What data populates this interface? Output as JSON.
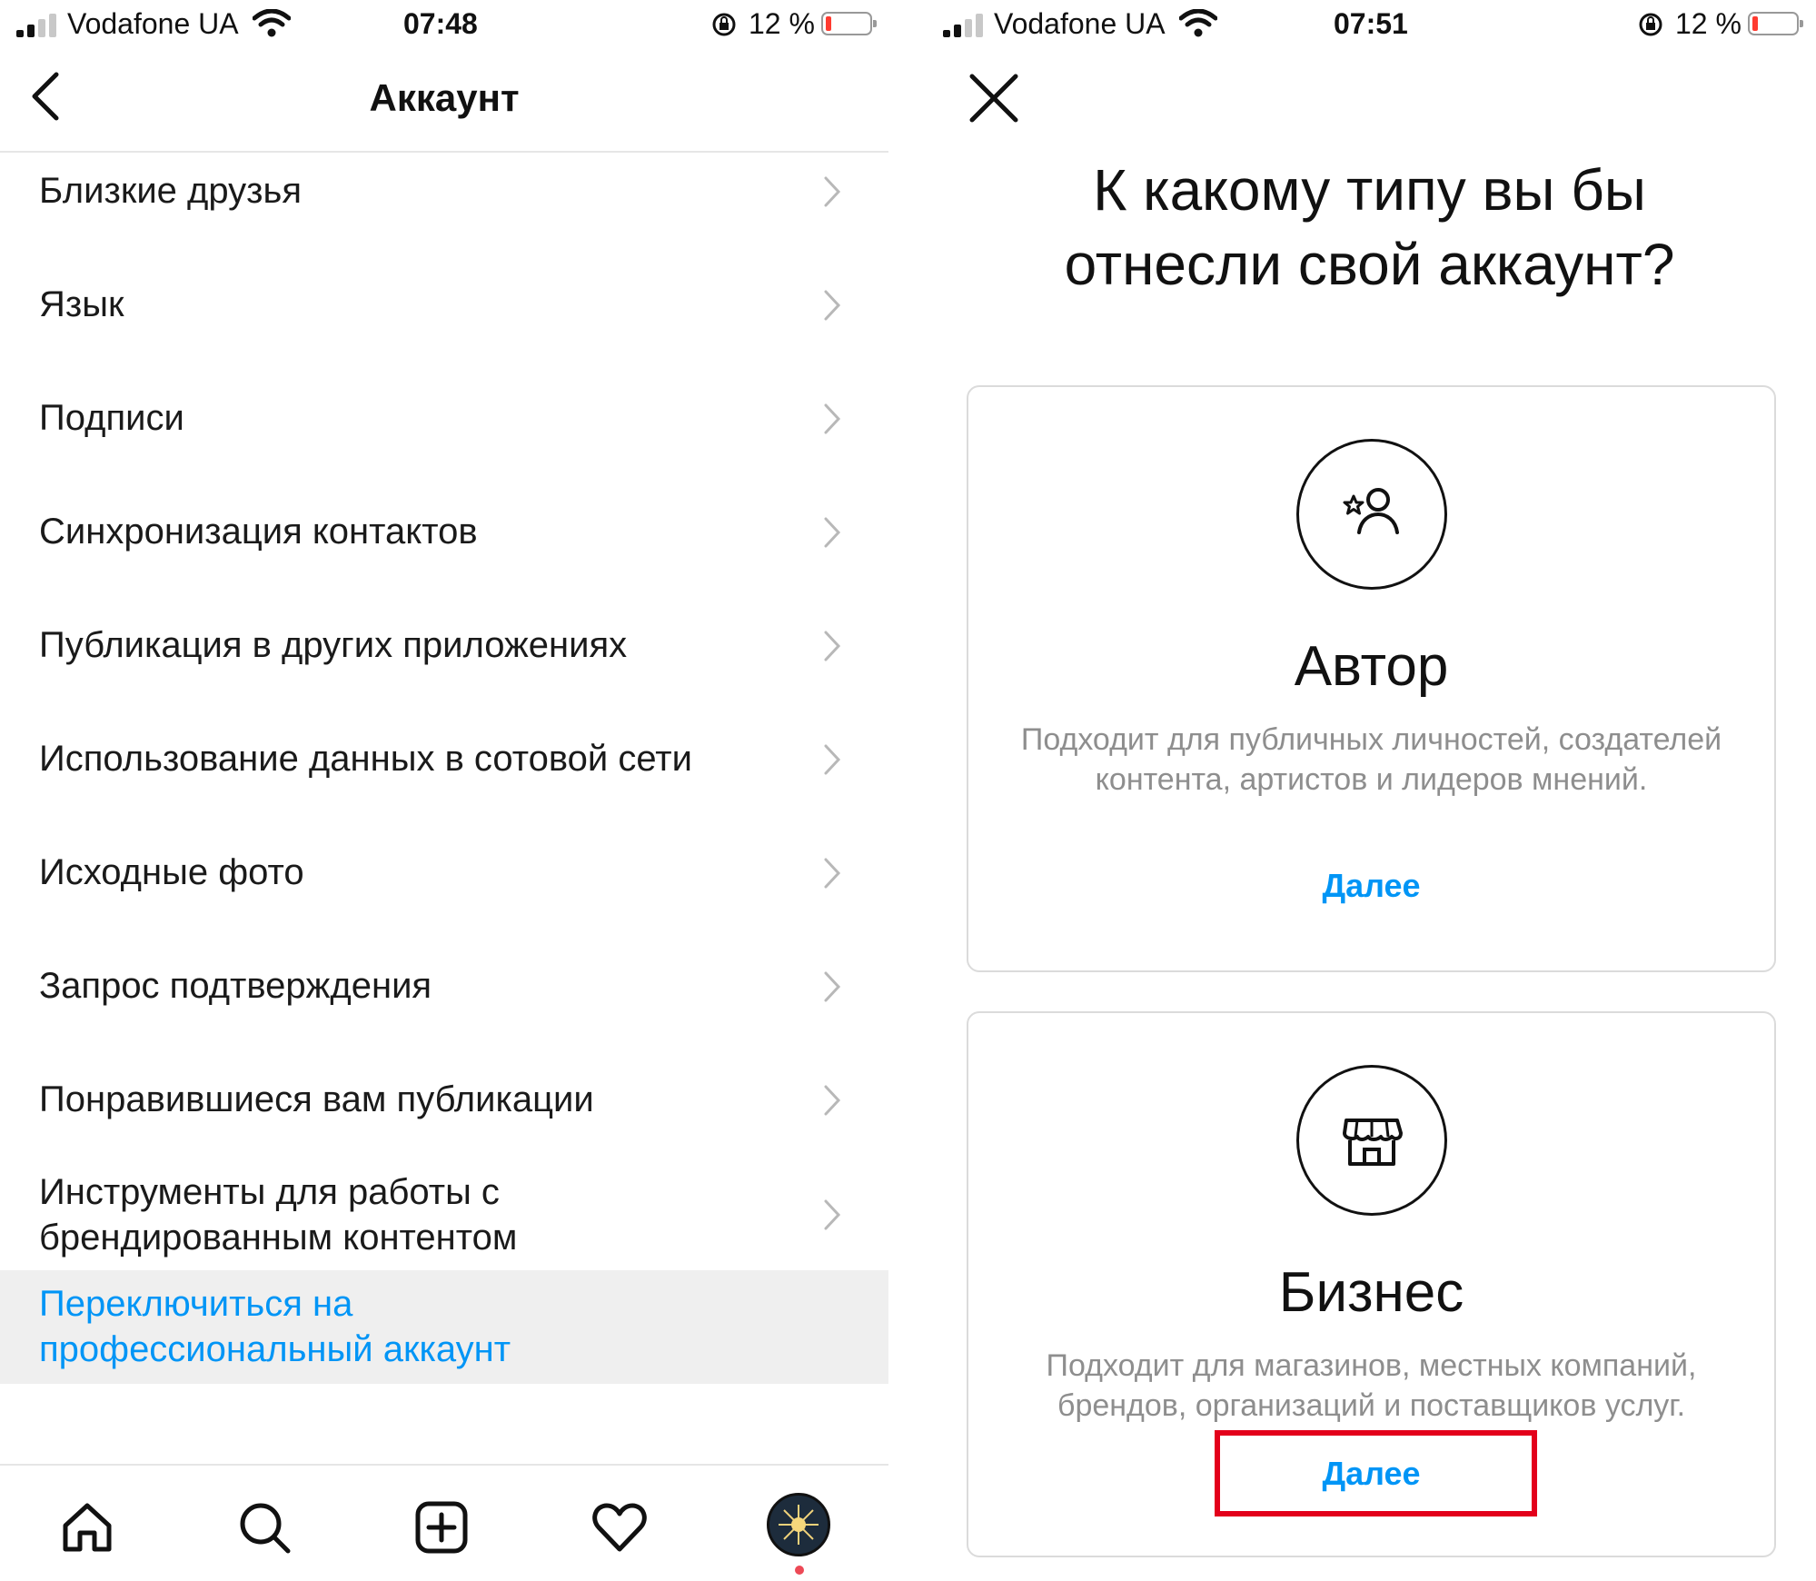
{
  "left_screen": {
    "status_bar": {
      "carrier": "Vodafone UA",
      "time": "07:48",
      "battery": "12 %"
    },
    "header": {
      "title": "Аккаунт"
    },
    "menu_items": [
      {
        "label": "Близкие друзья"
      },
      {
        "label": "Язык"
      },
      {
        "label": "Подписи"
      },
      {
        "label": "Синхронизация контактов"
      },
      {
        "label": "Публикация в других приложениях"
      },
      {
        "label": "Использование данных в сотовой сети"
      },
      {
        "label": "Исходные фото"
      },
      {
        "label": "Запрос подтверждения"
      },
      {
        "label": "Понравившиеся вам публикации"
      },
      {
        "label": "Инструменты для работы с брендированным контентом"
      }
    ],
    "switch_link": {
      "label": "Переключиться на профессиональный аккаунт"
    },
    "tab_bar": {
      "tabs": [
        "home-icon",
        "search-icon",
        "new-post-icon",
        "activity-heart-icon",
        "profile-avatar"
      ]
    }
  },
  "right_screen": {
    "status_bar": {
      "carrier": "Vodafone UA",
      "time": "07:51",
      "battery": "12 %"
    },
    "question": "К какому типу вы бы отнесли свой аккаунт?",
    "cards": [
      {
        "icon": "creator-icon",
        "title": "Автор",
        "description": "Подходит для публичных личностей, создателей контента, артистов и лидеров мнений.",
        "next_label": "Далее"
      },
      {
        "icon": "shop-icon",
        "title": "Бизнес",
        "description": "Подходит для магазинов, местных компаний, брендов, организаций и поставщиков услуг.",
        "next_label": "Далее",
        "highlighted": true
      }
    ]
  },
  "colors": {
    "link_blue": "#0095f6",
    "highlight_red": "#e3001b",
    "secondary_text": "#8e8e8e",
    "row_highlight": "#efefef"
  }
}
